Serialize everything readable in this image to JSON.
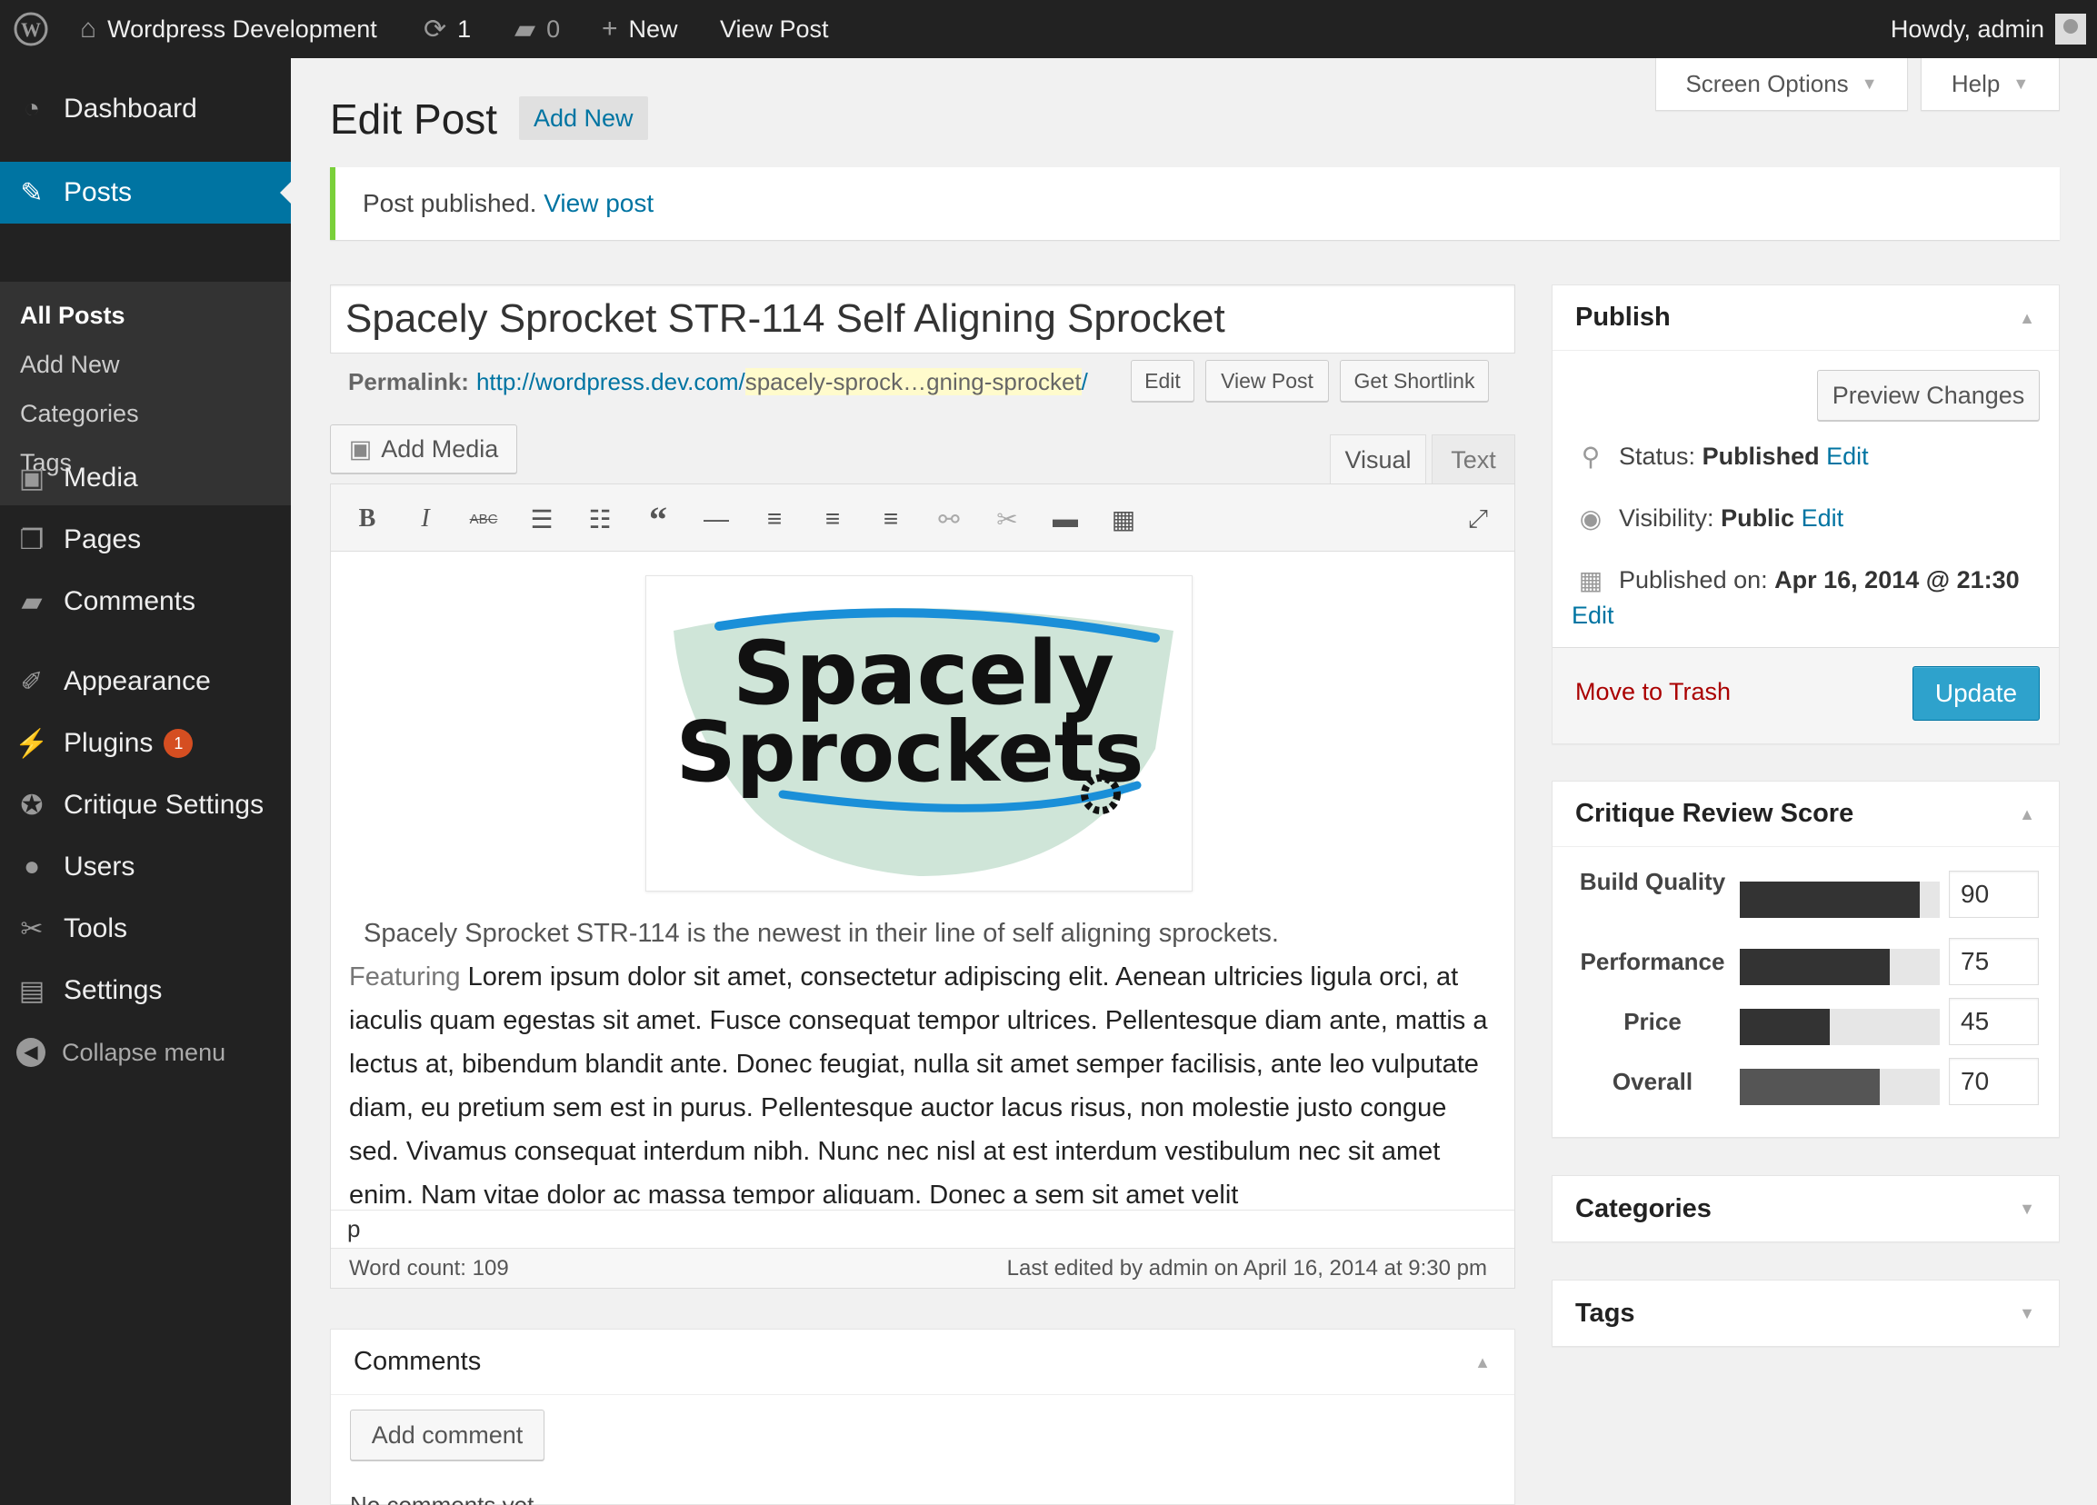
{
  "admin_bar": {
    "site_name": "Wordpress Development",
    "updates_count": "1",
    "comments_count": "0",
    "new_label": "New",
    "view_post_label": "View Post",
    "howdy": "Howdy, admin"
  },
  "sidebar": {
    "dashboard": "Dashboard",
    "posts": "Posts",
    "submenu": [
      "All Posts",
      "Add New",
      "Categories",
      "Tags"
    ],
    "media": "Media",
    "pages": "Pages",
    "comments": "Comments",
    "appearance": "Appearance",
    "plugins": "Plugins",
    "plugins_badge": "1",
    "critique": "Critique Settings",
    "users": "Users",
    "tools": "Tools",
    "settings": "Settings",
    "collapse": "Collapse menu"
  },
  "screen_options": {
    "screen_options_label": "Screen Options",
    "help_label": "Help"
  },
  "header": {
    "title": "Edit Post",
    "add_new": "Add New"
  },
  "notice": {
    "text": "Post published.",
    "link": "View post"
  },
  "post": {
    "title": "Spacely Sprocket STR-114 Self Aligning Sprocket",
    "permalink_label": "Permalink:",
    "permalink_base": "http://wordpress.dev.com/",
    "permalink_slug": "spacely-sprock…gning-sprocket",
    "permalink_end": "/",
    "edit_btn": "Edit",
    "view_post_btn": "View Post",
    "shortlink_btn": "Get Shortlink"
  },
  "editor": {
    "add_media": "Add Media",
    "tab_visual": "Visual",
    "tab_text": "Text",
    "logo_line1": "Spacely",
    "logo_line2": "Sprockets",
    "first_line": "Spacely Sprocket STR-114  is the newest in their line of self aligning sprockets.",
    "featuring": "Featuring",
    "body": "Lorem ipsum dolor sit amet, consectetur adipiscing elit. Aenean ultricies ligula orci, at iaculis quam egestas sit amet. Fusce consequat tempor ultrices. Pellentesque diam ante, mattis a lectus at, bibendum blandit ante. Donec feugiat, nulla sit amet semper facilisis, ante leo vulputate diam, eu pretium sem est in purus. Pellentesque auctor lacus risus, non molestie justo congue sed. Vivamus consequat interdum nibh. Nunc nec nisl at est interdum vestibulum nec sit amet enim. Nam vitae dolor ac massa tempor aliquam. Donec a sem sit amet velit",
    "path": "p",
    "word_count": "Word count: 109",
    "last_edited": "Last edited by admin on April 16, 2014 at 9:30 pm"
  },
  "comments_box": {
    "title": "Comments",
    "add_comment": "Add comment",
    "no_comments": "No comments yet."
  },
  "publish": {
    "title": "Publish",
    "preview": "Preview Changes",
    "status_label": "Status:",
    "status_value": "Published",
    "visibility_label": "Visibility:",
    "visibility_value": "Public",
    "published_on_label": "Published on:",
    "published_on_value": "Apr 16, 2014 @ 21:30",
    "edit": "Edit",
    "trash": "Move to Trash",
    "update": "Update"
  },
  "critique": {
    "title": "Critique Review Score",
    "rows": [
      {
        "label": "Build Quality",
        "value": "90",
        "fill": 0.9
      },
      {
        "label": "Performance",
        "value": "75",
        "fill": 0.75
      },
      {
        "label": "Price",
        "value": "45",
        "fill": 0.45
      },
      {
        "label": "Overall",
        "value": "70",
        "fill": 0.7
      }
    ]
  },
  "categories_box": {
    "title": "Categories"
  },
  "tags_box": {
    "title": "Tags"
  },
  "colors": {
    "accent": "#0074a2",
    "update_button": "#2ea2cc",
    "notice_border": "#7ad03a",
    "trash": "#aa0000"
  }
}
